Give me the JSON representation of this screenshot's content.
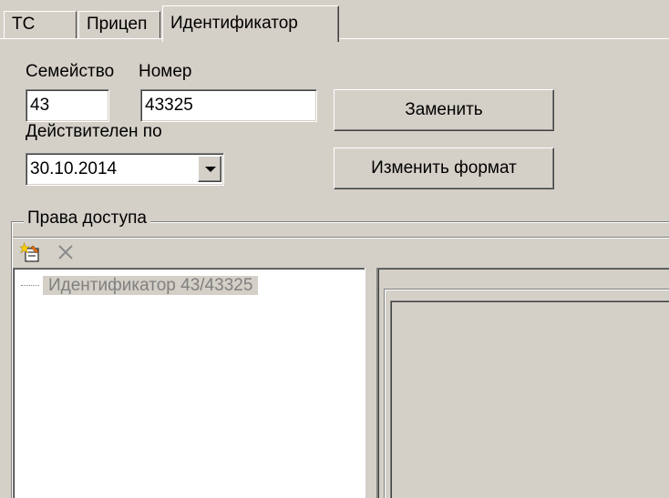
{
  "tabs": [
    {
      "label": "ТС",
      "active": false
    },
    {
      "label": "Прицеп",
      "active": false
    },
    {
      "label": "Идентификатор",
      "active": true
    }
  ],
  "form": {
    "family_label": "Семейство",
    "family_value": "43",
    "number_label": "Номер",
    "number_value": "43325",
    "valid_label": "Действителен по",
    "valid_value": "30.10.2014"
  },
  "buttons": {
    "replace": "Заменить",
    "change_format": "Изменить формат"
  },
  "access": {
    "group_title": "Права доступа",
    "toolbar": [
      {
        "name": "add-rights-icon"
      },
      {
        "name": "delete-icon"
      }
    ],
    "tree": [
      {
        "label": "Идентификатор 43/43325"
      }
    ]
  },
  "colors": {
    "face": "#d4d0c8",
    "shadow": "#808080",
    "highlight": "#ffffff",
    "window": "#ffffff",
    "disabled_text": "#808080"
  }
}
